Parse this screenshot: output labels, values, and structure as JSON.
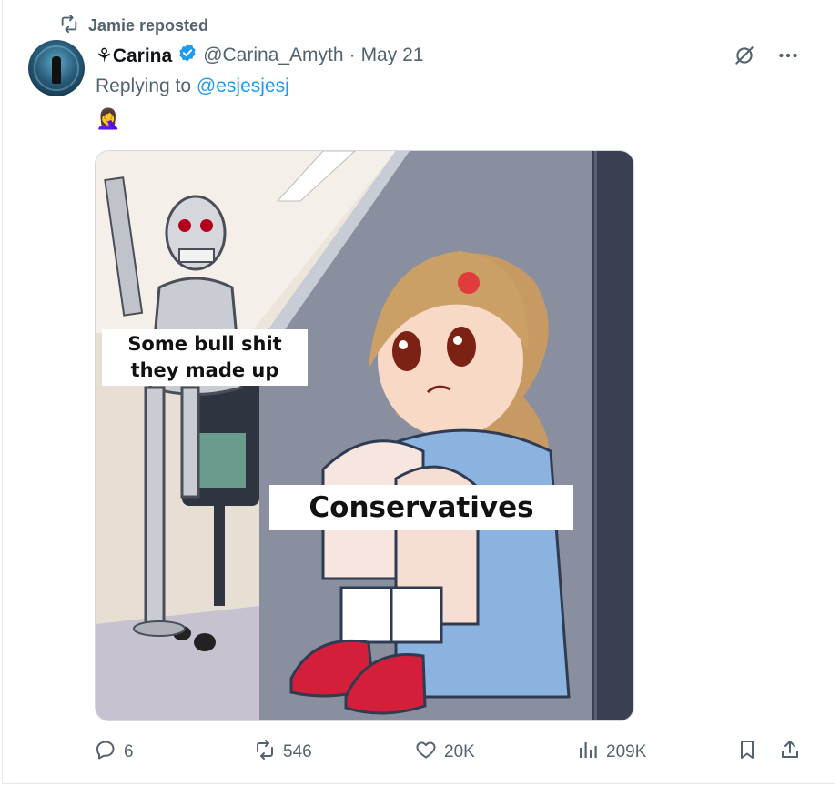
{
  "repost": {
    "label": "Jamie reposted"
  },
  "author": {
    "display_name": "⚘Carina",
    "handle": "@Carina_Amyth",
    "separator": "·",
    "date": "May 21"
  },
  "reply": {
    "prefix": "Replying to",
    "mention": "@esjesjesj"
  },
  "tweet_text": "🤦‍♀️",
  "media": {
    "captions": [
      "Some bull shit",
      "they made up",
      "Conservatives"
    ]
  },
  "actions": {
    "replies": "6",
    "reposts": "546",
    "likes": "20K",
    "views": "209K"
  },
  "colors": {
    "accent": "#1d9bf0",
    "muted": "#536471"
  },
  "icons": [
    "repost-icon",
    "verified-icon",
    "grok-icon",
    "more-icon",
    "reply-icon",
    "like-icon",
    "views-icon",
    "bookmark-icon",
    "share-icon"
  ]
}
